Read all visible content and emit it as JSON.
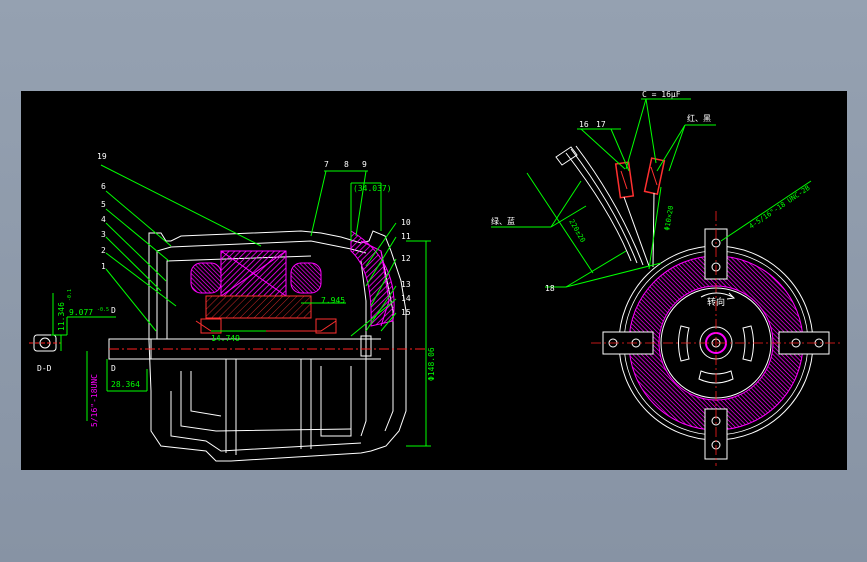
{
  "colors": {
    "background": "#8e9aab",
    "canvas": "#000000",
    "outline": "#ffffff",
    "dimension": "#00ff00",
    "hatch": "#ff00ff",
    "center": "#ff2020",
    "leader": "#00ff00"
  },
  "left_view": {
    "part_numbers": [
      "1",
      "2",
      "3",
      "4",
      "5",
      "6",
      "19",
      "7",
      "8",
      "9",
      "10",
      "11",
      "12",
      "13",
      "14",
      "15"
    ],
    "dimensions": {
      "top_width": "(34.037)",
      "height": "Φ148.06",
      "shaft_diameter": "11.346",
      "shaft_tol": "-0.1",
      "keyway": "9.077",
      "keyway_tol": "-0.5",
      "shaft_length": "28.364",
      "bearing_span": "14.749",
      "inner": "7.945",
      "thread": "5/16\"-18UNC"
    },
    "section_label": "D-D",
    "section_marks": [
      "D",
      "D"
    ]
  },
  "right_view": {
    "capacitor": "C = 16μF",
    "part_numbers": [
      "16",
      "17",
      "18"
    ],
    "wire_red_black": "红、黑",
    "wire_green_blue": "绿、蓝",
    "lead_length_a": "220±20",
    "lead_length_b": "Φ10×20",
    "thread_note": "4-5/16\"-18 UNC-2B",
    "rotation": "转向"
  }
}
